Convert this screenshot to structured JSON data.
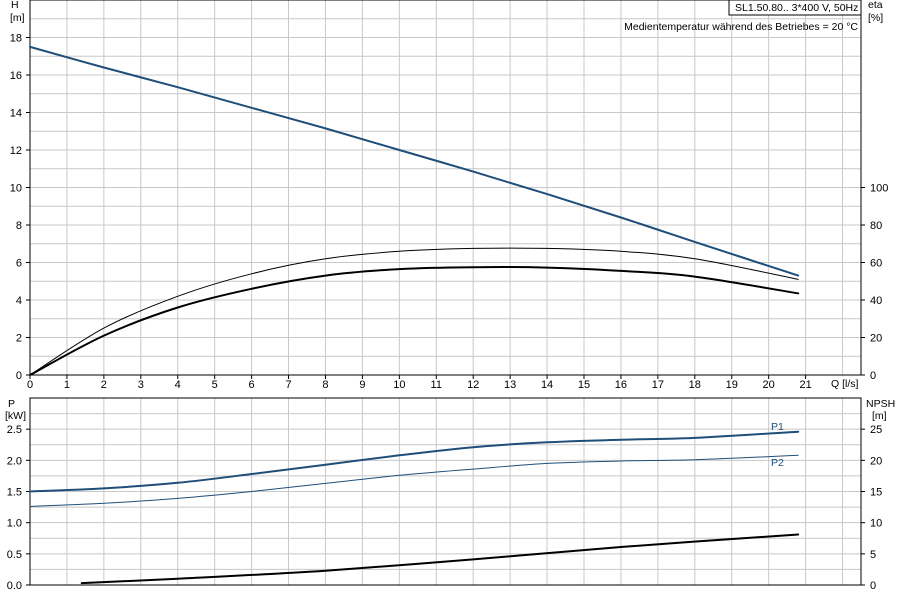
{
  "header": {
    "pump_model": "SL1.50.80.. 3*400 V, 50Hz",
    "medium_temp": "Medientemperatur während des Betriebes = 20 °C"
  },
  "colors": {
    "head_curve": "#1f4e79",
    "eta_curves": "#000000",
    "power_curves": "#1f4e79",
    "npsh_curve": "#000000",
    "grid": "#c8c8c8"
  },
  "chart_data": [
    {
      "type": "line",
      "panel": "top",
      "x_axis_label": "Q [l/s]",
      "left_axis": {
        "label": "H",
        "unit": "[m]",
        "range": [
          0,
          20
        ],
        "ticks": [
          0,
          2,
          4,
          6,
          8,
          10,
          12,
          14,
          16,
          18
        ]
      },
      "right_axis": {
        "label": "eta",
        "unit": "[%]",
        "range": [
          0,
          200
        ],
        "ticks": [
          0,
          20,
          40,
          60,
          80,
          100
        ]
      },
      "x_range": [
        0,
        22.5
      ],
      "x_ticks": [
        0,
        1,
        2,
        3,
        4,
        5,
        6,
        7,
        8,
        9,
        10,
        11,
        12,
        13,
        14,
        15,
        16,
        17,
        18,
        19,
        20,
        21
      ],
      "grid": true,
      "series": [
        {
          "axis": "left",
          "color": "#1f4e79",
          "width": 2,
          "x": [
            0,
            2,
            4,
            6,
            8,
            10,
            12,
            14,
            16,
            18,
            20.8
          ],
          "y": [
            17.5,
            16.4,
            15.35,
            14.25,
            13.15,
            12.0,
            10.85,
            9.65,
            8.4,
            7.1,
            5.3
          ]
        },
        {
          "axis": "right",
          "color": "#000000",
          "width": 1,
          "x": [
            0,
            2,
            4,
            6,
            8,
            10,
            12,
            14,
            16,
            18,
            20.8
          ],
          "y": [
            0,
            25,
            42,
            54,
            62,
            66,
            67.5,
            67.5,
            66,
            62,
            51
          ]
        },
        {
          "axis": "right",
          "color": "#000000",
          "width": 2,
          "x": [
            0,
            2,
            4,
            6,
            8,
            10,
            12,
            14,
            16,
            18,
            20.8
          ],
          "y": [
            0,
            21,
            36,
            46,
            53,
            56.5,
            57.5,
            57.3,
            55.5,
            52.5,
            43.5
          ]
        }
      ]
    },
    {
      "type": "line",
      "panel": "bottom",
      "left_axis": {
        "label": "P",
        "unit": "[kW]",
        "range": [
          0,
          3
        ],
        "ticks": [
          0.0,
          0.5,
          1.0,
          1.5,
          2.0,
          2.5
        ],
        "tick_labels": [
          "0.0",
          "0.5",
          "1.0",
          "1.5",
          "2.0",
          "2.5"
        ]
      },
      "right_axis": {
        "label": "NPSH",
        "unit": "[m]",
        "range": [
          0,
          30
        ],
        "ticks": [
          0,
          5,
          10,
          15,
          20,
          25
        ]
      },
      "x_range": [
        0,
        22.5
      ],
      "grid": true,
      "series": [
        {
          "name": "P1",
          "axis": "left",
          "color": "#1f4e79",
          "width": 2,
          "x": [
            0,
            2,
            4,
            6,
            8,
            10,
            12,
            14,
            16,
            18,
            20.8
          ],
          "y": [
            1.5,
            1.55,
            1.64,
            1.78,
            1.93,
            2.08,
            2.21,
            2.29,
            2.33,
            2.36,
            2.46
          ]
        },
        {
          "name": "P2",
          "axis": "left",
          "color": "#1f4e79",
          "width": 1,
          "x": [
            0,
            2,
            4,
            6,
            8,
            10,
            12,
            14,
            16,
            18,
            20.8
          ],
          "y": [
            1.26,
            1.31,
            1.39,
            1.5,
            1.63,
            1.76,
            1.86,
            1.95,
            1.99,
            2.01,
            2.08
          ]
        },
        {
          "axis": "right",
          "color": "#000000",
          "width": 2,
          "x": [
            1.4,
            4,
            8,
            12,
            16,
            20.8
          ],
          "y": [
            0.3,
            1.0,
            2.3,
            4.1,
            6.1,
            8.1
          ]
        }
      ]
    }
  ]
}
